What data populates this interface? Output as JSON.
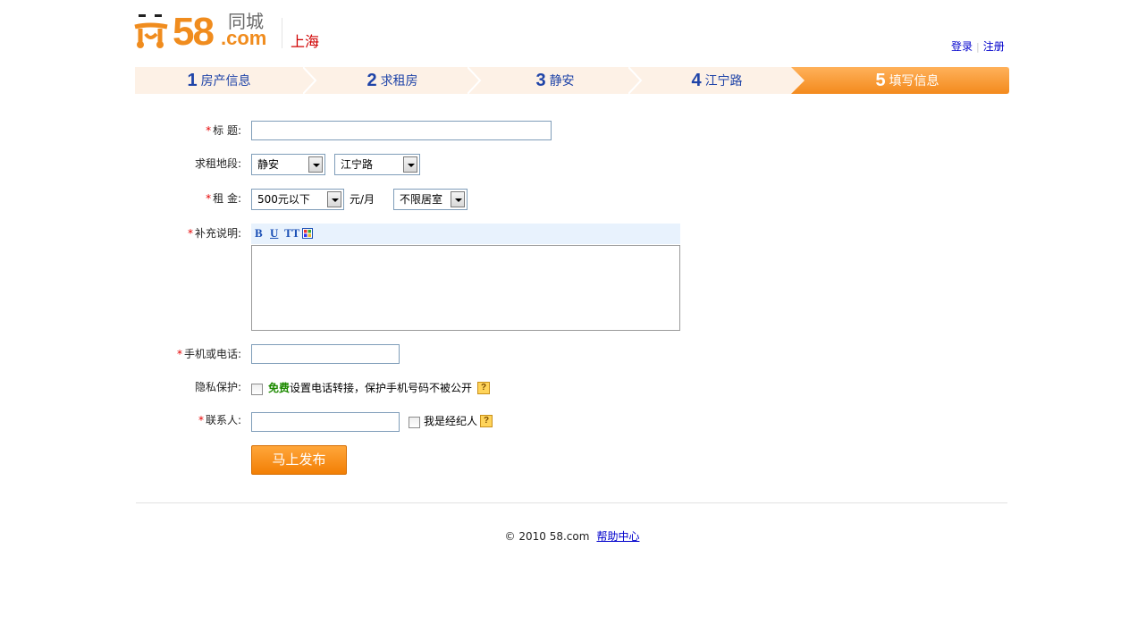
{
  "header": {
    "logo_number": "58",
    "logo_domain": ".com",
    "logo_cn": "同城",
    "city": "上海",
    "login": "登录",
    "register": "注册"
  },
  "steps": [
    {
      "num": "1",
      "label": "房产信息"
    },
    {
      "num": "2",
      "label": "求租房"
    },
    {
      "num": "3",
      "label": "静安"
    },
    {
      "num": "4",
      "label": "江宁路"
    },
    {
      "num": "5",
      "label": "填写信息",
      "active": true
    }
  ],
  "form": {
    "title_label": "标  题:",
    "title_value": "",
    "area_label": "求租地段:",
    "area_district": "静安",
    "area_street": "江宁路",
    "rent_label": "租  金:",
    "rent_value": "500元以下",
    "rent_unit": "元/月",
    "rooms_value": "不限居室",
    "desc_label": "补充说明:",
    "toolbar": {
      "bold": "B",
      "underline": "U",
      "fontsize": "TT"
    },
    "desc_value": "",
    "phone_label": "手机或电话:",
    "phone_value": "",
    "privacy_label": "隐私保护:",
    "privacy_free": "免费",
    "privacy_text": "设置电话转接，保护手机号码不被公开",
    "contact_label": "联系人:",
    "contact_value": "",
    "agent_label": "我是经纪人",
    "help_glyph": "?",
    "required_mark": "*",
    "submit": "马上发布"
  },
  "footer": {
    "copyright": "© 2010 58.com",
    "help": "帮助中心"
  },
  "colors": {
    "brand_orange": "#f08c1e",
    "step_text": "#1f44a8",
    "required": "#e60000",
    "link": "#0000cc"
  }
}
